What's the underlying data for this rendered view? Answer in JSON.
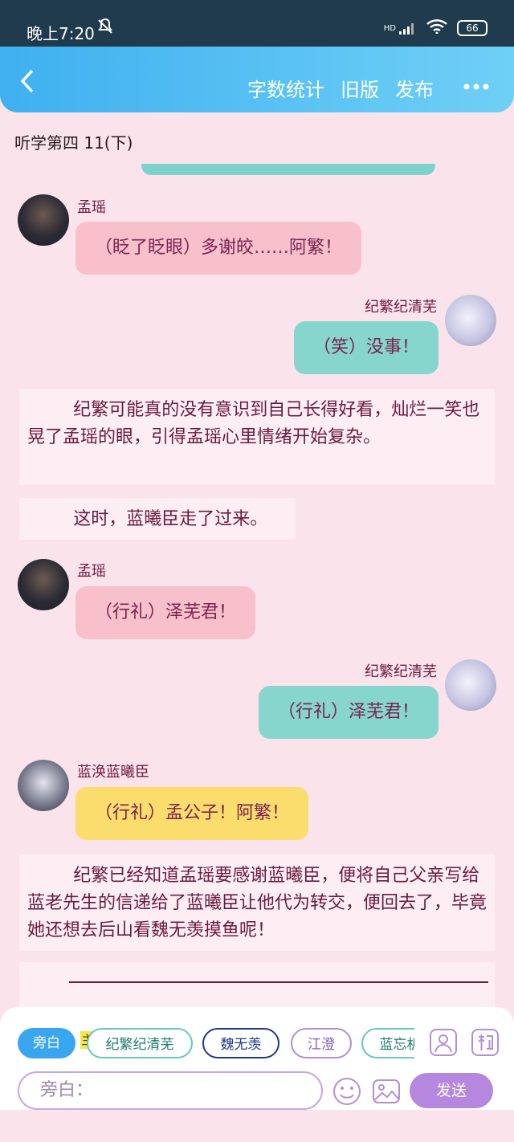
{
  "status": {
    "time": "晚上7:20",
    "battery": "66",
    "network": "HD"
  },
  "nav": {
    "word_count": "字数统计",
    "old_version": "旧版",
    "publish": "发布"
  },
  "chapter_title": "听学第四 11(下)",
  "messages": [
    {
      "name": "孟瑶",
      "text": "（眨了眨眼）多谢皎……阿繁！"
    },
    {
      "name": "纪繁纪清芜",
      "text": "（笑）没事！"
    },
    {
      "narration": "纪繁可能真的没有意识到自己长得好看，灿烂一笑也晃了孟瑶的眼，引得孟瑶心里情绪开始复杂。"
    },
    {
      "narration": "这时，蓝曦臣走了过来。"
    },
    {
      "name": "孟瑶",
      "text": "（行礼）泽芜君！"
    },
    {
      "name": "纪繁纪清芜",
      "text": "（行礼）泽芜君！"
    },
    {
      "name": "蓝涣蓝曦臣",
      "text": "（行礼）孟公子！阿繁！"
    },
    {
      "narration": "纪繁已经知道孟瑶要感谢蓝曦臣，便将自己父亲写给蓝老先生的信递给了蓝曦臣让他代为转交，便回去了，毕竟她还想去后山看魏无羡摸鱼呢！"
    }
  ],
  "roles": [
    "旁白",
    "纪繁纪清芜",
    "魏无羡",
    "江澄",
    "蓝忘机"
  ],
  "main_badge": "主",
  "input": {
    "placeholder": "旁白："
  },
  "send_label": "发送",
  "icons": {
    "back": "back-icon",
    "more": "more-icon",
    "bell": "bell-off-icon",
    "wifi": "wifi-icon",
    "signal": "signal-icon",
    "emoji": "emoji-icon",
    "image": "image-icon",
    "role": "role-icon",
    "tag": "tag-icon"
  }
}
